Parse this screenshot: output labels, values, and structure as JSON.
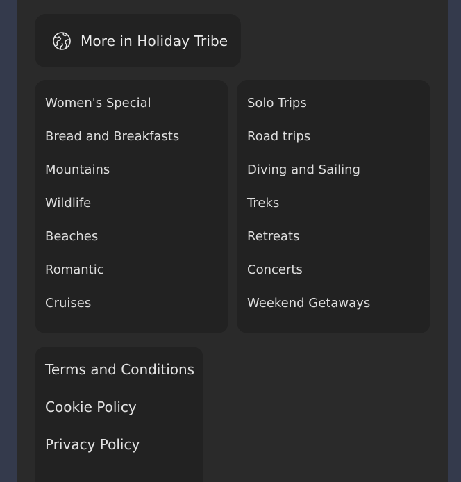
{
  "header": {
    "icon": "globe-icon",
    "title": "More in Holiday Tribe"
  },
  "categories": {
    "left": [
      "Women's Special",
      "Bread and Breakfasts",
      "Mountains",
      "Wildlife",
      "Beaches",
      "Romantic",
      "Cruises"
    ],
    "right": [
      "Solo Trips",
      "Road trips",
      "Diving and Sailing",
      "Treks",
      "Retreats",
      "Concerts",
      "Weekend Getaways"
    ]
  },
  "legal": [
    "Terms and Conditions",
    "Cookie Policy",
    "Privacy Policy"
  ],
  "colors": {
    "page_background": "#343a4c",
    "panel_background": "#2a2a2a",
    "card_background": "#222222",
    "text": "#e3e3e3"
  }
}
